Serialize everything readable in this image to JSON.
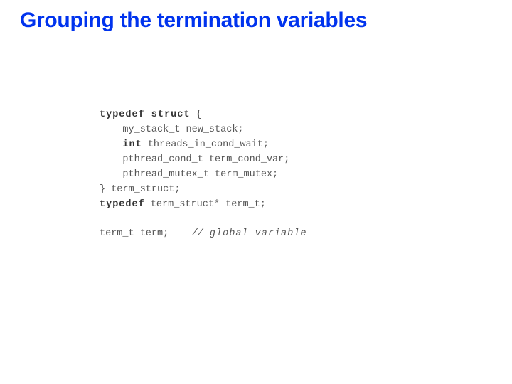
{
  "slide": {
    "title": "Grouping the termination variables"
  },
  "code": {
    "line1_kw": "typedef struct",
    "line1_rest": " {",
    "line2": "    my_stack_t new_stack;",
    "line3_kw": "int",
    "line3_rest": " threads_in_cond_wait;",
    "line4": "    pthread_cond_t term_cond_var;",
    "line5": "    pthread_mutex_t term_mutex;",
    "line6": "} term_struct;",
    "line7_kw": "typedef",
    "line7_rest": " term_struct* term_t;",
    "line9_a": "term_t term;",
    "line9_slash": "//",
    "line9_comment": " global variable"
  }
}
